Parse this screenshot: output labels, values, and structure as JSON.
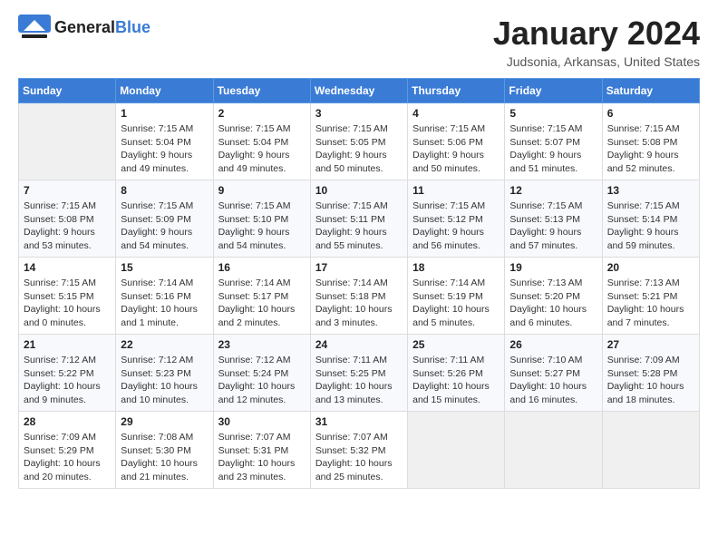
{
  "header": {
    "logo_general": "General",
    "logo_blue": "Blue",
    "title": "January 2024",
    "subtitle": "Judsonia, Arkansas, United States"
  },
  "weekdays": [
    "Sunday",
    "Monday",
    "Tuesday",
    "Wednesday",
    "Thursday",
    "Friday",
    "Saturday"
  ],
  "weeks": [
    [
      {
        "day": "",
        "sunrise": "",
        "sunset": "",
        "daylight": ""
      },
      {
        "day": "1",
        "sunrise": "Sunrise: 7:15 AM",
        "sunset": "Sunset: 5:04 PM",
        "daylight": "Daylight: 9 hours and 49 minutes."
      },
      {
        "day": "2",
        "sunrise": "Sunrise: 7:15 AM",
        "sunset": "Sunset: 5:04 PM",
        "daylight": "Daylight: 9 hours and 49 minutes."
      },
      {
        "day": "3",
        "sunrise": "Sunrise: 7:15 AM",
        "sunset": "Sunset: 5:05 PM",
        "daylight": "Daylight: 9 hours and 50 minutes."
      },
      {
        "day": "4",
        "sunrise": "Sunrise: 7:15 AM",
        "sunset": "Sunset: 5:06 PM",
        "daylight": "Daylight: 9 hours and 50 minutes."
      },
      {
        "day": "5",
        "sunrise": "Sunrise: 7:15 AM",
        "sunset": "Sunset: 5:07 PM",
        "daylight": "Daylight: 9 hours and 51 minutes."
      },
      {
        "day": "6",
        "sunrise": "Sunrise: 7:15 AM",
        "sunset": "Sunset: 5:08 PM",
        "daylight": "Daylight: 9 hours and 52 minutes."
      }
    ],
    [
      {
        "day": "7",
        "sunrise": "Sunrise: 7:15 AM",
        "sunset": "Sunset: 5:08 PM",
        "daylight": "Daylight: 9 hours and 53 minutes."
      },
      {
        "day": "8",
        "sunrise": "Sunrise: 7:15 AM",
        "sunset": "Sunset: 5:09 PM",
        "daylight": "Daylight: 9 hours and 54 minutes."
      },
      {
        "day": "9",
        "sunrise": "Sunrise: 7:15 AM",
        "sunset": "Sunset: 5:10 PM",
        "daylight": "Daylight: 9 hours and 54 minutes."
      },
      {
        "day": "10",
        "sunrise": "Sunrise: 7:15 AM",
        "sunset": "Sunset: 5:11 PM",
        "daylight": "Daylight: 9 hours and 55 minutes."
      },
      {
        "day": "11",
        "sunrise": "Sunrise: 7:15 AM",
        "sunset": "Sunset: 5:12 PM",
        "daylight": "Daylight: 9 hours and 56 minutes."
      },
      {
        "day": "12",
        "sunrise": "Sunrise: 7:15 AM",
        "sunset": "Sunset: 5:13 PM",
        "daylight": "Daylight: 9 hours and 57 minutes."
      },
      {
        "day": "13",
        "sunrise": "Sunrise: 7:15 AM",
        "sunset": "Sunset: 5:14 PM",
        "daylight": "Daylight: 9 hours and 59 minutes."
      }
    ],
    [
      {
        "day": "14",
        "sunrise": "Sunrise: 7:15 AM",
        "sunset": "Sunset: 5:15 PM",
        "daylight": "Daylight: 10 hours and 0 minutes."
      },
      {
        "day": "15",
        "sunrise": "Sunrise: 7:14 AM",
        "sunset": "Sunset: 5:16 PM",
        "daylight": "Daylight: 10 hours and 1 minute."
      },
      {
        "day": "16",
        "sunrise": "Sunrise: 7:14 AM",
        "sunset": "Sunset: 5:17 PM",
        "daylight": "Daylight: 10 hours and 2 minutes."
      },
      {
        "day": "17",
        "sunrise": "Sunrise: 7:14 AM",
        "sunset": "Sunset: 5:18 PM",
        "daylight": "Daylight: 10 hours and 3 minutes."
      },
      {
        "day": "18",
        "sunrise": "Sunrise: 7:14 AM",
        "sunset": "Sunset: 5:19 PM",
        "daylight": "Daylight: 10 hours and 5 minutes."
      },
      {
        "day": "19",
        "sunrise": "Sunrise: 7:13 AM",
        "sunset": "Sunset: 5:20 PM",
        "daylight": "Daylight: 10 hours and 6 minutes."
      },
      {
        "day": "20",
        "sunrise": "Sunrise: 7:13 AM",
        "sunset": "Sunset: 5:21 PM",
        "daylight": "Daylight: 10 hours and 7 minutes."
      }
    ],
    [
      {
        "day": "21",
        "sunrise": "Sunrise: 7:12 AM",
        "sunset": "Sunset: 5:22 PM",
        "daylight": "Daylight: 10 hours and 9 minutes."
      },
      {
        "day": "22",
        "sunrise": "Sunrise: 7:12 AM",
        "sunset": "Sunset: 5:23 PM",
        "daylight": "Daylight: 10 hours and 10 minutes."
      },
      {
        "day": "23",
        "sunrise": "Sunrise: 7:12 AM",
        "sunset": "Sunset: 5:24 PM",
        "daylight": "Daylight: 10 hours and 12 minutes."
      },
      {
        "day": "24",
        "sunrise": "Sunrise: 7:11 AM",
        "sunset": "Sunset: 5:25 PM",
        "daylight": "Daylight: 10 hours and 13 minutes."
      },
      {
        "day": "25",
        "sunrise": "Sunrise: 7:11 AM",
        "sunset": "Sunset: 5:26 PM",
        "daylight": "Daylight: 10 hours and 15 minutes."
      },
      {
        "day": "26",
        "sunrise": "Sunrise: 7:10 AM",
        "sunset": "Sunset: 5:27 PM",
        "daylight": "Daylight: 10 hours and 16 minutes."
      },
      {
        "day": "27",
        "sunrise": "Sunrise: 7:09 AM",
        "sunset": "Sunset: 5:28 PM",
        "daylight": "Daylight: 10 hours and 18 minutes."
      }
    ],
    [
      {
        "day": "28",
        "sunrise": "Sunrise: 7:09 AM",
        "sunset": "Sunset: 5:29 PM",
        "daylight": "Daylight: 10 hours and 20 minutes."
      },
      {
        "day": "29",
        "sunrise": "Sunrise: 7:08 AM",
        "sunset": "Sunset: 5:30 PM",
        "daylight": "Daylight: 10 hours and 21 minutes."
      },
      {
        "day": "30",
        "sunrise": "Sunrise: 7:07 AM",
        "sunset": "Sunset: 5:31 PM",
        "daylight": "Daylight: 10 hours and 23 minutes."
      },
      {
        "day": "31",
        "sunrise": "Sunrise: 7:07 AM",
        "sunset": "Sunset: 5:32 PM",
        "daylight": "Daylight: 10 hours and 25 minutes."
      },
      {
        "day": "",
        "sunrise": "",
        "sunset": "",
        "daylight": ""
      },
      {
        "day": "",
        "sunrise": "",
        "sunset": "",
        "daylight": ""
      },
      {
        "day": "",
        "sunrise": "",
        "sunset": "",
        "daylight": ""
      }
    ]
  ]
}
